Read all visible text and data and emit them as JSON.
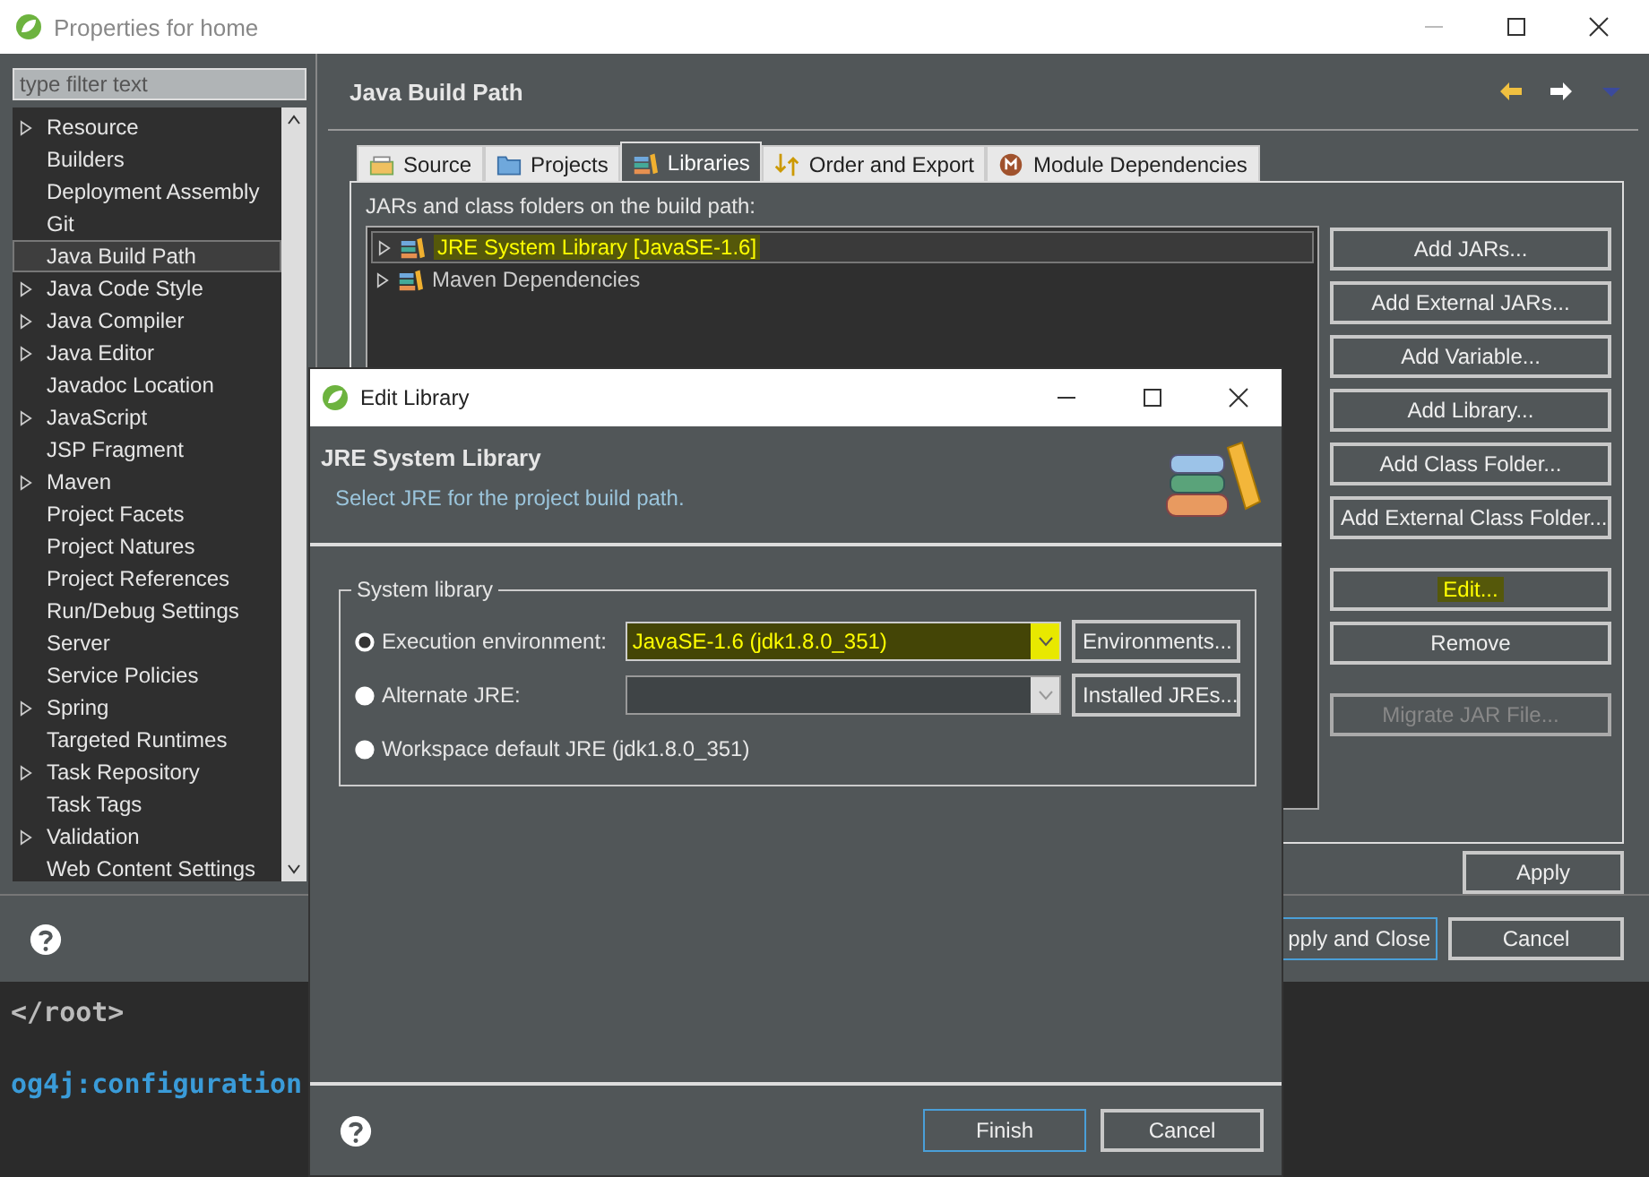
{
  "main_window": {
    "title": "Properties for home",
    "filter": {
      "placeholder": "type filter text"
    },
    "nav": [
      {
        "label": "Resource",
        "has_children": true,
        "selected": false
      },
      {
        "label": "Builders",
        "has_children": false,
        "selected": false
      },
      {
        "label": "Deployment Assembly",
        "has_children": false,
        "selected": false
      },
      {
        "label": "Git",
        "has_children": false,
        "selected": false
      },
      {
        "label": "Java Build Path",
        "has_children": false,
        "selected": true
      },
      {
        "label": "Java Code Style",
        "has_children": true,
        "selected": false
      },
      {
        "label": "Java Compiler",
        "has_children": true,
        "selected": false
      },
      {
        "label": "Java Editor",
        "has_children": true,
        "selected": false
      },
      {
        "label": "Javadoc Location",
        "has_children": false,
        "selected": false
      },
      {
        "label": "JavaScript",
        "has_children": true,
        "selected": false
      },
      {
        "label": "JSP Fragment",
        "has_children": false,
        "selected": false
      },
      {
        "label": "Maven",
        "has_children": true,
        "selected": false
      },
      {
        "label": "Project Facets",
        "has_children": false,
        "selected": false
      },
      {
        "label": "Project Natures",
        "has_children": false,
        "selected": false
      },
      {
        "label": "Project References",
        "has_children": false,
        "selected": false
      },
      {
        "label": "Run/Debug Settings",
        "has_children": false,
        "selected": false
      },
      {
        "label": "Server",
        "has_children": false,
        "selected": false
      },
      {
        "label": "Service Policies",
        "has_children": false,
        "selected": false
      },
      {
        "label": "Spring",
        "has_children": true,
        "selected": false
      },
      {
        "label": "Targeted Runtimes",
        "has_children": false,
        "selected": false
      },
      {
        "label": "Task Repository",
        "has_children": true,
        "selected": false
      },
      {
        "label": "Task Tags",
        "has_children": false,
        "selected": false
      },
      {
        "label": "Validation",
        "has_children": true,
        "selected": false
      },
      {
        "label": "Web Content Settings",
        "has_children": false,
        "selected": false
      }
    ],
    "page": {
      "title": "Java Build Path",
      "tabs": [
        {
          "label": "Source",
          "selected": false
        },
        {
          "label": "Projects",
          "selected": false
        },
        {
          "label": "Libraries",
          "selected": true
        },
        {
          "label": "Order and Export",
          "selected": false
        },
        {
          "label": "Module Dependencies",
          "selected": false
        }
      ],
      "list_label": "JARs and class folders on the build path:",
      "entries": [
        {
          "label": "JRE System Library [JavaSE-1.6]",
          "highlighted": true
        },
        {
          "label": "Maven Dependencies",
          "highlighted": false
        }
      ],
      "button_groups": [
        [
          {
            "label": "Add JARs...",
            "disabled": false,
            "highlighted": false
          },
          {
            "label": "Add External JARs...",
            "disabled": false,
            "highlighted": false
          },
          {
            "label": "Add Variable...",
            "disabled": false,
            "highlighted": false
          },
          {
            "label": "Add Library...",
            "disabled": false,
            "highlighted": false
          },
          {
            "label": "Add Class Folder...",
            "disabled": false,
            "highlighted": false
          },
          {
            "label": "Add External Class Folder...",
            "disabled": false,
            "highlighted": false
          }
        ],
        [
          {
            "label": "Edit...",
            "disabled": false,
            "highlighted": true
          },
          {
            "label": "Remove",
            "disabled": false,
            "highlighted": false
          }
        ],
        [
          {
            "label": "Migrate JAR File...",
            "disabled": true,
            "highlighted": false
          }
        ]
      ],
      "apply": "Apply"
    },
    "footer_buttons": [
      {
        "label": "pply and Close",
        "default": true
      },
      {
        "label": "Cancel",
        "default": false
      }
    ]
  },
  "editor": {
    "lines": [
      "</root>",
      "og4j:configuration"
    ]
  },
  "dialog": {
    "title": "Edit Library",
    "heading": "JRE System Library",
    "description": "Select JRE for the project build path.",
    "group_label": "System library",
    "options": [
      {
        "label": "Execution environment:",
        "selected": true,
        "combo": {
          "value": "JavaSE-1.6 (jdk1.8.0_351)",
          "highlighted": true,
          "disabled": false
        },
        "button": "Environments..."
      },
      {
        "label": "Alternate JRE:",
        "selected": false,
        "combo": {
          "highlighted": false,
          "disabled": true
        },
        "button": "Installed JREs..."
      },
      {
        "label": "Workspace default JRE (jdk1.8.0_351)",
        "selected": false
      }
    ],
    "buttons": [
      {
        "label": "Finish",
        "default": true
      },
      {
        "label": "Cancel",
        "default": false
      }
    ]
  }
}
